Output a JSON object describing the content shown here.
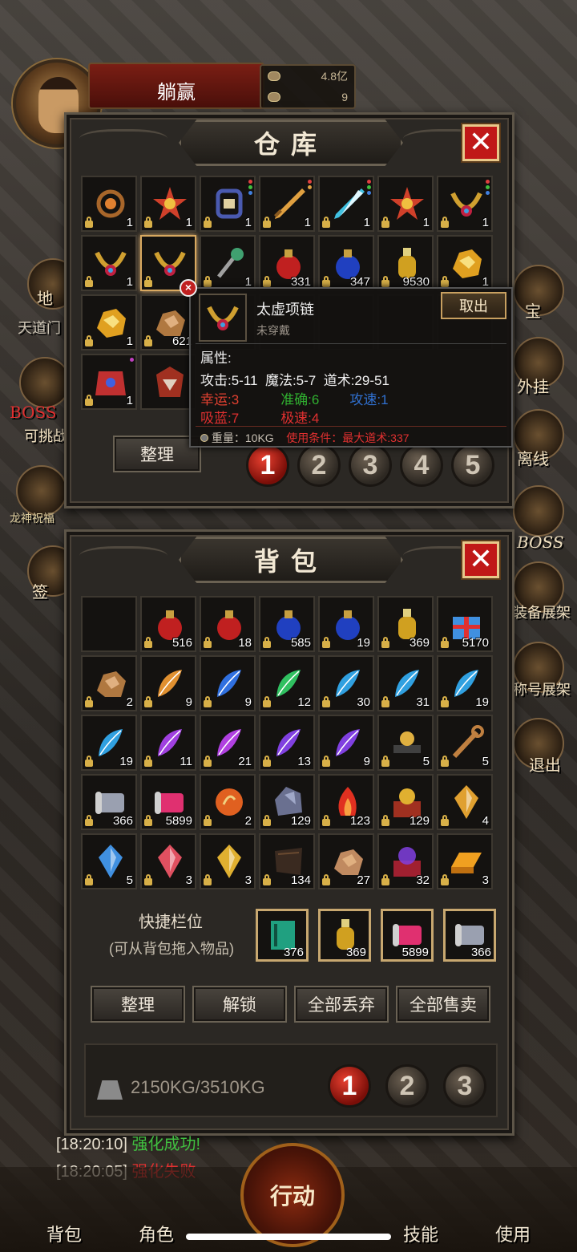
{
  "player": {
    "name": "躺赢",
    "gold": "4.8亿",
    "ingots": "9"
  },
  "side_left": {
    "map_label": "地",
    "zone": "天道门",
    "boss": "BOSS",
    "challenge": "可挑战",
    "dragon": "龙神祝福",
    "sign": "签"
  },
  "side_right": {
    "items": [
      "宝",
      "外挂",
      "离线",
      "BOSS",
      "装备展架",
      "称号展架",
      "退出"
    ]
  },
  "warehouse": {
    "title": "仓库",
    "close_symbol": "✕",
    "sort_label": "整理",
    "pages": [
      "1",
      "2",
      "3",
      "4",
      "5"
    ],
    "active_page": 0,
    "slots": [
      {
        "icon": "ring-icon",
        "count": "1",
        "locked": true,
        "color": "#a8662a",
        "dots": []
      },
      {
        "icon": "flower-medal-icon",
        "count": "1",
        "locked": true,
        "color": "#d0402a",
        "dots": []
      },
      {
        "icon": "bracelet-icon",
        "count": "1",
        "locked": true,
        "color": "#4a5ab0",
        "dots": [
          "#e04040",
          "#40c040",
          "#4080e0"
        ]
      },
      {
        "icon": "sword-icon",
        "count": "1",
        "locked": true,
        "color": "#e0a040",
        "dots": [
          "#e04040",
          "#e0a040"
        ]
      },
      {
        "icon": "ice-sword-icon",
        "count": "1",
        "locked": true,
        "color": "#40c0e0",
        "dots": [
          "#e04040",
          "#40c040",
          "#4080e0"
        ]
      },
      {
        "icon": "flower-medal-icon",
        "count": "1",
        "locked": true,
        "color": "#d0402a",
        "dots": []
      },
      {
        "icon": "necklace-icon",
        "count": "1",
        "locked": true,
        "color": "#d0a030",
        "dots": [
          "#e04040",
          "#40c040",
          "#4080e0"
        ]
      },
      {
        "icon": "necklace-icon",
        "count": "1",
        "locked": true,
        "color": "#d0a030",
        "dots": []
      },
      {
        "icon": "necklace-icon",
        "count": "",
        "locked": true,
        "color": "#d0a030",
        "dots": [],
        "selected": true
      },
      {
        "icon": "jade-pendant-icon",
        "count": "1",
        "locked": true,
        "color": "#40a070",
        "dots": []
      },
      {
        "icon": "red-potion-icon",
        "count": "331",
        "locked": true,
        "color": "#c02020",
        "dots": []
      },
      {
        "icon": "blue-potion-icon",
        "count": "347",
        "locked": true,
        "color": "#2040c0",
        "dots": []
      },
      {
        "icon": "sun-potion-icon",
        "count": "9530",
        "locked": true,
        "color": "#d0a020",
        "dots": []
      },
      {
        "icon": "gold-ore-icon",
        "count": "1",
        "locked": true,
        "color": "#e0a020",
        "dots": []
      },
      {
        "icon": "gold-ore-icon",
        "count": "1",
        "locked": true,
        "color": "#e0a020",
        "dots": []
      },
      {
        "icon": "copper-ore-icon",
        "count": "621",
        "locked": true,
        "color": "#b07840",
        "dots": []
      },
      {
        "icon": "",
        "count": "",
        "locked": false,
        "color": "",
        "dots": []
      },
      {
        "icon": "",
        "count": "",
        "locked": false,
        "color": "",
        "dots": []
      },
      {
        "icon": "",
        "count": "",
        "locked": false,
        "color": "",
        "dots": []
      },
      {
        "icon": "",
        "count": "",
        "locked": false,
        "color": "",
        "dots": []
      },
      {
        "icon": "",
        "count": "",
        "locked": false,
        "color": "",
        "dots": []
      },
      {
        "icon": "dragon-armor-icon",
        "count": "1",
        "locked": true,
        "color": "#c03030",
        "dots": [
          "#c040c0"
        ]
      },
      {
        "icon": "demon-helm-icon",
        "count": "",
        "locked": false,
        "color": "#a03020",
        "dots": []
      }
    ]
  },
  "tooltip": {
    "item_icon": "necklace-icon",
    "name": "太虚项链",
    "status": "未穿戴",
    "take_out": "取出",
    "attr_header": "属性:",
    "line1": [
      "攻击:5-11",
      "魔法:5-7",
      "道术:29-51"
    ],
    "line2": [
      "幸运:3",
      "准确:6",
      "攻速:1"
    ],
    "line3": [
      "吸蓝:7",
      "极速:4"
    ],
    "weight": "重量：10KG",
    "requirement": "使用条件：最大道术:337",
    "colors": {
      "luck": "#e04030",
      "accuracy": "#30b030",
      "speed": "#3070d0",
      "drain": "#e03030",
      "haste": "#e03030",
      "req": "#e03030"
    }
  },
  "bag": {
    "title": "背包",
    "close_symbol": "✕",
    "slots": [
      {
        "icon": "",
        "count": "",
        "locked": false,
        "color": ""
      },
      {
        "icon": "red-potion-icon",
        "count": "516",
        "locked": true,
        "color": "#c02020"
      },
      {
        "icon": "red-potion-icon",
        "count": "18",
        "locked": true,
        "color": "#c02020"
      },
      {
        "icon": "blue-potion-icon",
        "count": "585",
        "locked": true,
        "color": "#2040c0"
      },
      {
        "icon": "blue-potion-icon",
        "count": "19",
        "locked": true,
        "color": "#2040c0"
      },
      {
        "icon": "sun-potion-icon",
        "count": "369",
        "locked": true,
        "color": "#d0a020"
      },
      {
        "icon": "gift-box-icon",
        "count": "5170",
        "locked": true,
        "color": "#4090e0"
      },
      {
        "icon": "copper-ore-icon",
        "count": "2",
        "locked": true,
        "color": "#b07840"
      },
      {
        "icon": "feather-icon",
        "count": "9",
        "locked": true,
        "color": "#e09030"
      },
      {
        "icon": "feather-icon",
        "count": "9",
        "locked": true,
        "color": "#3070e0"
      },
      {
        "icon": "feather-icon",
        "count": "12",
        "locked": true,
        "color": "#30c060"
      },
      {
        "icon": "feather-icon",
        "count": "30",
        "locked": true,
        "color": "#30a0e0"
      },
      {
        "icon": "feather-icon",
        "count": "31",
        "locked": true,
        "color": "#30a0e0"
      },
      {
        "icon": "feather-icon",
        "count": "19",
        "locked": true,
        "color": "#30a0e0"
      },
      {
        "icon": "feather-icon",
        "count": "19",
        "locked": true,
        "color": "#30a0e0"
      },
      {
        "icon": "feather-icon",
        "count": "11",
        "locked": true,
        "color": "#a040e0"
      },
      {
        "icon": "feather-icon",
        "count": "21",
        "locked": true,
        "color": "#b040e0"
      },
      {
        "icon": "feather-icon",
        "count": "13",
        "locked": true,
        "color": "#8040e0"
      },
      {
        "icon": "feather-icon",
        "count": "9",
        "locked": true,
        "color": "#8040e0"
      },
      {
        "icon": "anvil-icon",
        "count": "5",
        "locked": true,
        "color": "#e0b040"
      },
      {
        "icon": "wrench-icon",
        "count": "5",
        "locked": true,
        "color": "#c08040"
      },
      {
        "icon": "scroll-icon",
        "count": "366",
        "locked": true,
        "color": "#9aa0b0"
      },
      {
        "icon": "scroll-icon",
        "count": "5899",
        "locked": true,
        "color": "#e03070"
      },
      {
        "icon": "orb-icon",
        "count": "2",
        "locked": true,
        "color": "#e06020"
      },
      {
        "icon": "stone-icon",
        "count": "129",
        "locked": true,
        "color": "#6a7090"
      },
      {
        "icon": "fire-icon",
        "count": "123",
        "locked": true,
        "color": "#e03020"
      },
      {
        "icon": "treasure-icon",
        "count": "129",
        "locked": true,
        "color": "#e0b030"
      },
      {
        "icon": "crystal-icon",
        "count": "4",
        "locked": true,
        "color": "#e0a030"
      },
      {
        "icon": "crystal-icon",
        "count": "5",
        "locked": true,
        "color": "#4090e0"
      },
      {
        "icon": "crystal-icon",
        "count": "3",
        "locked": true,
        "color": "#e05060"
      },
      {
        "icon": "crystal-icon",
        "count": "3",
        "locked": true,
        "color": "#e0b030"
      },
      {
        "icon": "cloth-icon",
        "count": "134",
        "locked": true,
        "color": "#3a2a20"
      },
      {
        "icon": "copper-ore-icon",
        "count": "27",
        "locked": true,
        "color": "#c08a60"
      },
      {
        "icon": "magic-box-icon",
        "count": "32",
        "locked": true,
        "color": "#8040e0"
      },
      {
        "icon": "gold-bar-icon",
        "count": "3",
        "locked": true,
        "color": "#f0a020"
      }
    ],
    "quick_title": "快捷栏位",
    "quick_hint": "(可从背包拖入物品)",
    "quick_slots": [
      {
        "icon": "book-icon",
        "count": "376",
        "color": "#20a080"
      },
      {
        "icon": "sun-potion-icon",
        "count": "369",
        "color": "#d0a020"
      },
      {
        "icon": "scroll-icon",
        "count": "5899",
        "color": "#e03070"
      },
      {
        "icon": "scroll-icon",
        "count": "366",
        "color": "#9aa0b0"
      }
    ],
    "buttons": [
      "整理",
      "解锁",
      "全部丢弃",
      "全部售卖"
    ],
    "weight": "2150KG/3510KG",
    "pages": [
      "1",
      "2",
      "3"
    ],
    "active_page": 0
  },
  "chat": [
    {
      "time": "[18:20:10]",
      "msg": "强化成功!",
      "color": "#40c040"
    },
    {
      "time": "[18:20:05]",
      "msg": "强化失败",
      "color": "#e03030"
    }
  ],
  "bottom": {
    "bag": "背包",
    "role": "角色",
    "action": "行动",
    "skill": "技能",
    "use": "使用"
  }
}
